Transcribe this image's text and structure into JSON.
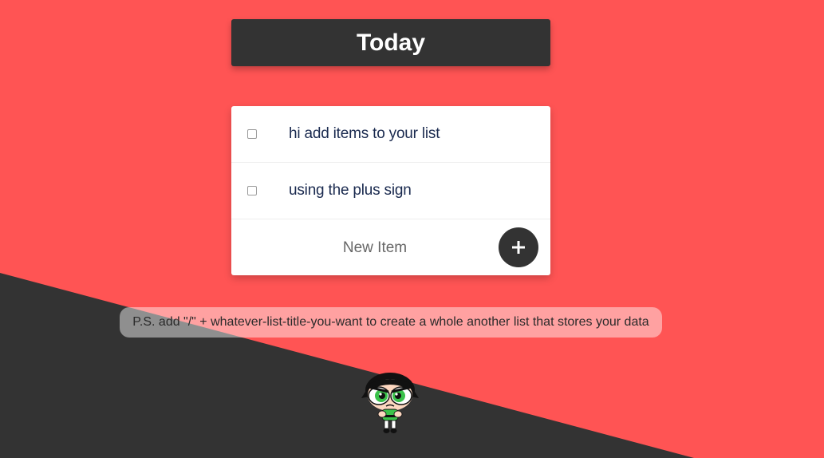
{
  "header": {
    "title": "Today"
  },
  "list": {
    "items": [
      {
        "label": "hi add items to your list",
        "checked": false
      },
      {
        "label": "using the plus sign",
        "checked": false
      }
    ],
    "new_item_placeholder": "New Item",
    "add_icon": "plus-icon"
  },
  "note": {
    "text": "P.S. add \"/\" + whatever-list-title-you-want to create a whole another list that stores your data"
  },
  "mascot": {
    "icon": "buttercup-illustration"
  },
  "colors": {
    "background": "#ff5454",
    "dark": "#333333",
    "card": "#ffffff",
    "item_text": "#1a2a4f"
  }
}
